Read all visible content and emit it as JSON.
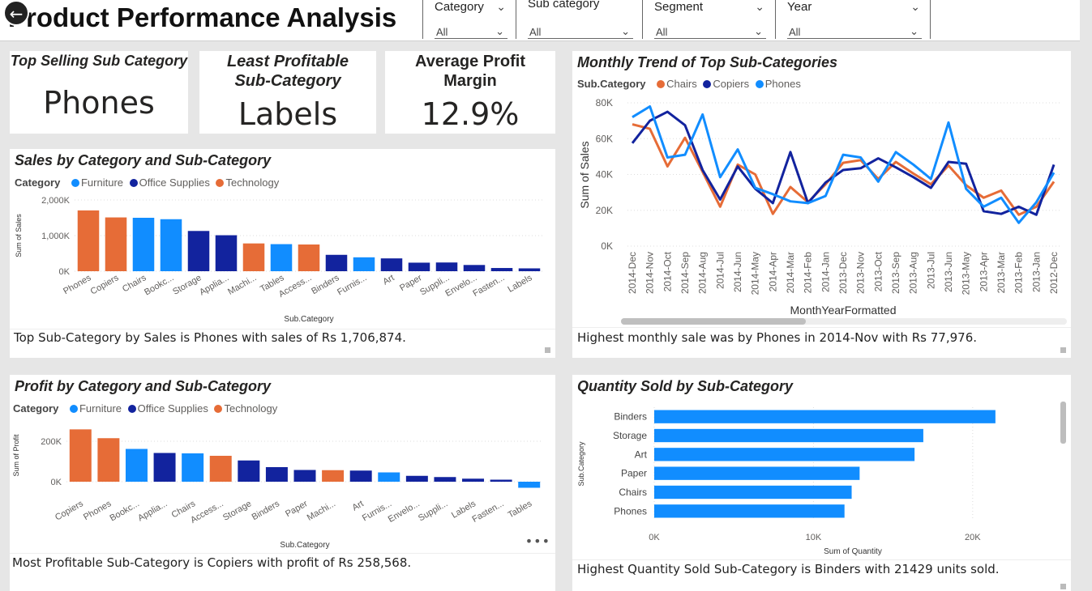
{
  "header": {
    "title": "Product Performance Analysis",
    "back_icon": "circle-arrow-left-icon",
    "slicers": [
      {
        "label": "Category",
        "value": "All"
      },
      {
        "label": "Sub category",
        "value": "All"
      },
      {
        "label": "Segment",
        "value": "All"
      },
      {
        "label": "Year",
        "value": "All"
      }
    ]
  },
  "kpis": {
    "top_selling": {
      "title": "Top Selling Sub Category",
      "value": "Phones"
    },
    "least_profitable": {
      "title_line1": "Least Profitable",
      "title_line2": "Sub-Category",
      "value": "Labels"
    },
    "avg_margin": {
      "title_line1": "Average Profit",
      "title_line2": "Margin",
      "value": "12.9%"
    }
  },
  "colors": {
    "furniture": "#118DFF",
    "office_supplies": "#12239E",
    "technology": "#E66C37",
    "bar": "#118DFF"
  },
  "legend": {
    "title": "Category",
    "furniture": "Furniture",
    "office_supplies": "Office Supplies",
    "technology": "Technology"
  },
  "sales_summary": "Top Sub-Category by Sales is Phones with sales of Rs 1,706,874.",
  "profit_summary": "Most Profitable Sub-Category is Copiers with profit of Rs 258,568.",
  "trend_summary": "Highest monthly sale was by Phones in 2014-Nov with Rs 77,976.",
  "quantity_summary": "Highest Quantity Sold Sub-Category is Binders with 21429 units sold.",
  "chart_data": [
    {
      "id": "sales",
      "type": "bar",
      "title": "Sales by Category and Sub-Category",
      "xlabel": "Sub.Category",
      "ylabel": "Sum of Sales",
      "ylim": [
        0,
        2000000
      ],
      "yticks": [
        0,
        1000000,
        2000000
      ],
      "ytick_labels": [
        "0K",
        "1,000K",
        "2,000K"
      ],
      "categories": [
        "Phones",
        "Copiers",
        "Chairs",
        "Bookc...",
        "Storage",
        "Applia...",
        "Machi...",
        "Tables",
        "Access...",
        "Binders",
        "Furnis...",
        "Art",
        "Paper",
        "Suppli...",
        "Envelo...",
        "Fasten...",
        "Labels"
      ],
      "values": [
        1706874,
        1510000,
        1500000,
        1460000,
        1130000,
        1010000,
        780000,
        760000,
        750000,
        460000,
        390000,
        360000,
        240000,
        245000,
        175000,
        90000,
        80000
      ],
      "groups": [
        "Technology",
        "Technology",
        "Furniture",
        "Furniture",
        "Office Supplies",
        "Office Supplies",
        "Technology",
        "Furniture",
        "Technology",
        "Office Supplies",
        "Furniture",
        "Office Supplies",
        "Office Supplies",
        "Office Supplies",
        "Office Supplies",
        "Office Supplies",
        "Office Supplies"
      ]
    },
    {
      "id": "profit",
      "type": "bar",
      "title": "Profit by Category and Sub-Category",
      "xlabel": "Sub.Category",
      "ylabel": "Sum of Profit",
      "ylim": [
        -40000,
        300000
      ],
      "yticks": [
        0,
        200000
      ],
      "ytick_labels": [
        "0K",
        "200K"
      ],
      "categories": [
        "Copiers",
        "Phones",
        "Bookc...",
        "Applia...",
        "Chairs",
        "Access...",
        "Storage",
        "Binders",
        "Paper",
        "Machi...",
        "Art",
        "Furnis...",
        "Envelo...",
        "Suppli...",
        "Labels",
        "Fasten...",
        "Tables"
      ],
      "values": [
        258568,
        215000,
        162000,
        142000,
        140000,
        128000,
        105000,
        72000,
        58000,
        57000,
        55000,
        46000,
        29000,
        23000,
        15000,
        10000,
        -30000
      ],
      "groups": [
        "Technology",
        "Technology",
        "Furniture",
        "Office Supplies",
        "Furniture",
        "Technology",
        "Office Supplies",
        "Office Supplies",
        "Office Supplies",
        "Technology",
        "Office Supplies",
        "Furniture",
        "Office Supplies",
        "Office Supplies",
        "Office Supplies",
        "Office Supplies",
        "Furniture"
      ]
    },
    {
      "id": "trend",
      "type": "line",
      "title": "Monthly Trend of Top Sub-Categories",
      "xlabel": "MonthYearFormatted",
      "ylabel": "Sum of Sales",
      "legend_title": "Sub.Category",
      "ylim": [
        0,
        80000
      ],
      "yticks": [
        0,
        20000,
        40000,
        60000,
        80000
      ],
      "ytick_labels": [
        "0K",
        "20K",
        "40K",
        "60K",
        "80K"
      ],
      "x": [
        "2014-Dec",
        "2014-Nov",
        "2014-Oct",
        "2014-Sep",
        "2014-Aug",
        "2014-Jul",
        "2014-Jun",
        "2014-May",
        "2014-Apr",
        "2014-Mar",
        "2014-Feb",
        "2014-Jan",
        "2013-Dec",
        "2013-Nov",
        "2013-Oct",
        "2013-Sep",
        "2013-Aug",
        "2013-Jul",
        "2013-Jun",
        "2013-May",
        "2013-Apr",
        "2013-Mar",
        "2013-Feb",
        "2013-Jan",
        "2012-Dec"
      ],
      "series": [
        {
          "name": "Chairs",
          "color": "#E66C37",
          "values": [
            68000,
            65500,
            44500,
            60500,
            41500,
            22000,
            45500,
            40000,
            18000,
            33000,
            24500,
            34500,
            46500,
            48000,
            37500,
            47000,
            40500,
            34500,
            45000,
            34000,
            27000,
            31000,
            17500,
            22000,
            36000
          ]
        },
        {
          "name": "Copiers",
          "color": "#12239E",
          "values": [
            57500,
            70000,
            75000,
            67500,
            42500,
            26000,
            44500,
            32000,
            24000,
            52500,
            24000,
            35500,
            42500,
            43500,
            49000,
            44000,
            38500,
            32500,
            47000,
            46000,
            19500,
            18000,
            22000,
            17500,
            45500
          ]
        },
        {
          "name": "Phones",
          "color": "#118DFF",
          "values": [
            72000,
            77976,
            49500,
            51000,
            73500,
            38500,
            54000,
            32500,
            29000,
            25000,
            24000,
            28000,
            51000,
            49500,
            36000,
            52500,
            45500,
            37500,
            69000,
            32000,
            22000,
            27000,
            13000,
            24500,
            41000
          ]
        }
      ]
    },
    {
      "id": "quantity",
      "type": "bar",
      "orientation": "horizontal",
      "title": "Quantity Sold by Sub-Category",
      "xlabel": "Sum of Quantity",
      "ylabel": "Sub.Category",
      "xlim": [
        0,
        25000
      ],
      "xticks": [
        0,
        10000,
        20000
      ],
      "xtick_labels": [
        "0K",
        "10K",
        "20K"
      ],
      "categories": [
        "Binders",
        "Storage",
        "Art",
        "Paper",
        "Chairs",
        "Phones"
      ],
      "values": [
        21429,
        16900,
        16350,
        12900,
        12400,
        11950
      ]
    }
  ]
}
